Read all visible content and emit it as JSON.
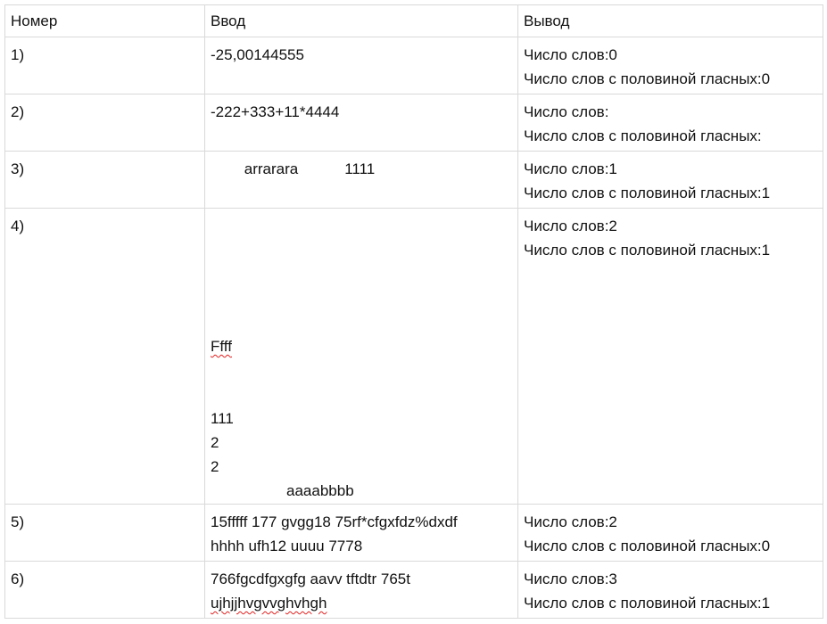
{
  "headers": {
    "number": "Номер",
    "input": "Ввод",
    "output": "Вывод"
  },
  "rows": [
    {
      "number": "1)",
      "input": [
        "-25,00144555"
      ],
      "output": [
        "Число слов:0",
        "Число слов с половиной гласных:0"
      ]
    },
    {
      "number": "2)",
      "input": [
        "-222+333+11*4444"
      ],
      "output": [
        "Число слов:",
        "Число слов с половиной гласных:"
      ]
    },
    {
      "number": "3)",
      "input": [
        "        arrarara           1111"
      ],
      "output": [
        "Число слов:1",
        "Число слов с половиной гласных:1"
      ]
    },
    {
      "number": "4)",
      "input": [
        "Ffff",
        "111",
        "2",
        "2",
        "                  aaaabbbb"
      ],
      "output": [
        "Число слов:2",
        "Число слов с половиной гласных:1"
      ]
    },
    {
      "number": "5)",
      "input": [
        "15fffff 177 gvgg18 75rf*cfgxfdz%dxdf",
        "hhhh ufh12 uuuu 7778"
      ],
      "output": [
        "Число слов:2",
        "Число слов с половиной гласных:0"
      ]
    },
    {
      "number": "6)",
      "input": [
        "766fgcdfgxgfg aavv tftdtr 765t",
        "ujhjjhvgvvghvhgh"
      ],
      "output": [
        "Число слов:3",
        "Число слов с половиной гласных:1"
      ]
    }
  ]
}
